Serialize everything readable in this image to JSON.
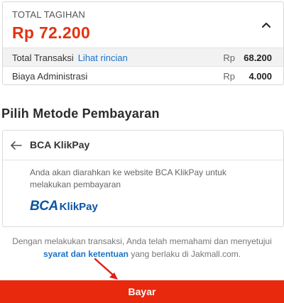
{
  "bill": {
    "label": "TOTAL TAGIHAN",
    "amount": "Rp 72.200",
    "rows": [
      {
        "label": "Total Transaksi",
        "link": "Lihat rincian",
        "currency": "Rp",
        "value": "68.200"
      },
      {
        "label": "Biaya Administrasi",
        "link": "",
        "currency": "Rp",
        "value": "4.000"
      }
    ]
  },
  "payment": {
    "section_title": "Pilih Metode Pembayaran",
    "method_name": "BCA KlikPay",
    "description": "Anda akan diarahkan ke website BCA KlikPay untuk melakukan pembayaran",
    "logo_bca": "BCA",
    "logo_klikpay": "KlikPay"
  },
  "notice": {
    "text_before": "Dengan melakukan transaksi, Anda telah memahami dan menyetujui",
    "link": "syarat dan ketentuan",
    "text_after": " yang berlaku di Jakmall.com."
  },
  "pay_button": {
    "label": "Bayar"
  },
  "colors": {
    "accent": "#e8290d",
    "link": "#1a73c9",
    "brand_bca": "#0b56a4"
  },
  "icons": {
    "collapse": "chevron-up-icon",
    "back": "arrow-left-icon",
    "annotation": "red-arrow-annotation"
  }
}
